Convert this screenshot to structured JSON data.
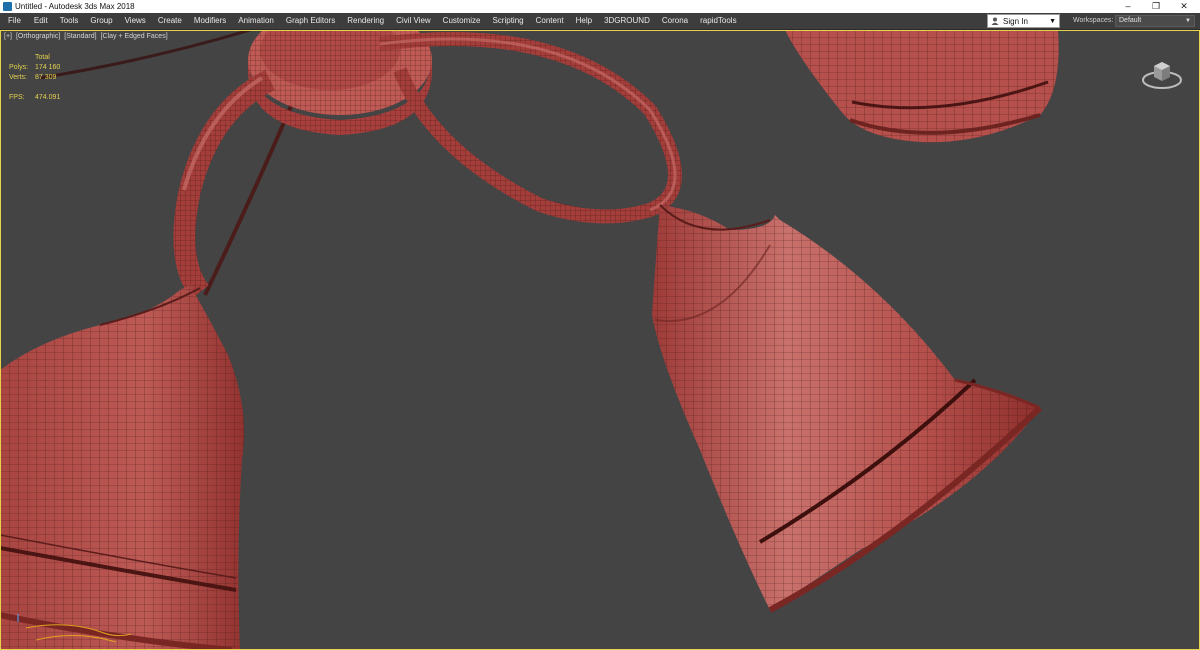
{
  "window": {
    "title": "Untitled - Autodesk 3ds Max 2018",
    "controls": [
      "–",
      "❐",
      "✕"
    ]
  },
  "menu": [
    "File",
    "Edit",
    "Tools",
    "Group",
    "Views",
    "Create",
    "Modifiers",
    "Animation",
    "Graph Editors",
    "Rendering",
    "Civil View",
    "Customize",
    "Scripting",
    "Content",
    "Help",
    "3DGROUND",
    "Corona",
    "rapidTools"
  ],
  "account": {
    "signin_label": "Sign In"
  },
  "workspaces": {
    "label": "Workspaces:",
    "value": "Default"
  },
  "viewport": {
    "label_parts": [
      "[+]",
      "[Orthographic]",
      "[Standard]",
      "[Clay + Edged Faces]"
    ],
    "stats": {
      "total_label": "Total",
      "polys_label": "Polys:",
      "polys_value": "174 160",
      "verts_label": "Verts:",
      "verts_value": "87 309",
      "fps_label": "FPS:",
      "fps_value": "474.091"
    },
    "colors": {
      "background": "#444444",
      "clay": "#b84c48",
      "clay_dark": "#7a2724",
      "wire": "#3a1010",
      "stats_text": "#e3d24f",
      "active_border": "#e6d34a"
    }
  }
}
